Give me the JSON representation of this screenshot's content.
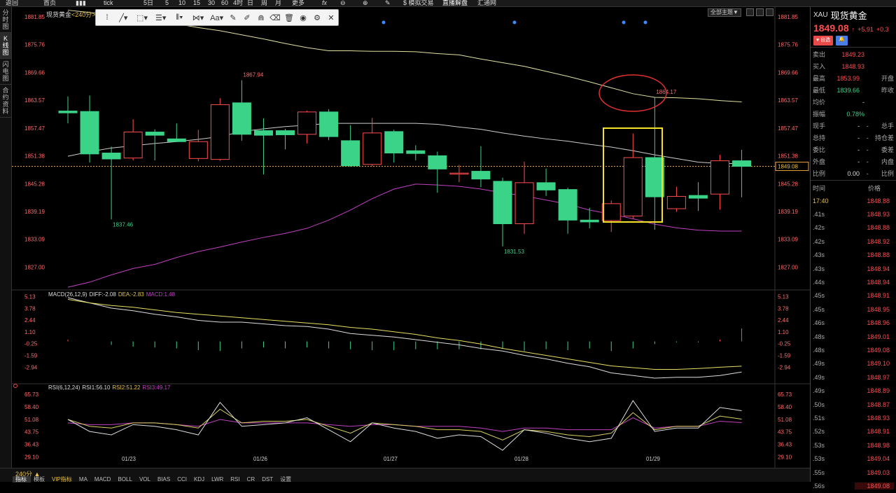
{
  "topbar": {
    "items": [
      "返回",
      "首页",
      "",
      "tick",
      "5日",
      "5",
      "10",
      "15",
      "30",
      "60",
      "4时",
      "日",
      "周",
      "月",
      "更多",
      "fx",
      "",
      "",
      "",
      "$ 模拟交易",
      "直播解盘",
      "汇通网"
    ]
  },
  "left_tabs": [
    "分时图",
    "K线图",
    "闪电图",
    "合约资料"
  ],
  "chart": {
    "title": "现货黄金",
    "period_suffix": "<240分>",
    "scheme_button": "全部主题▼",
    "price_axis": [
      "1881.85",
      "1875.76",
      "1869.66",
      "1863.57",
      "1857.47",
      "1851.38",
      "1845.28",
      "1839.19",
      "1833.09",
      "1827.00"
    ],
    "current_price_tag": "1849.08",
    "annotations": {
      "high1": "1867.94",
      "low1": "1837.46",
      "low2": "1831.53",
      "high2": "1864.17"
    },
    "macd_label": "MACD(26,12,9)",
    "macd_diff": "DIFF:-2.08",
    "macd_dea": "DEA:-2.83",
    "macd_macd": "MACD:1.48",
    "macd_axis": [
      "5.13",
      "3.78",
      "2.44",
      "1.10",
      "-0.25",
      "-1.59",
      "-2.94"
    ],
    "rsi_label": "RSI(6,12,24)",
    "rsi1": "RSI1:56.10",
    "rsi2": "RSI2:51.22",
    "rsi3": "RSI3:49.17",
    "rsi_axis": [
      "65.73",
      "58.40",
      "51.08",
      "43.75",
      "36.43",
      "29.10"
    ],
    "dates": [
      "01/23",
      "01/26",
      "01/27",
      "01/28",
      "01/29"
    ],
    "colors": {
      "up": "#ff4d4f",
      "down": "#3bd388",
      "ma1": "#e0e0a0",
      "ma2": "#cccccc",
      "ma3": "#c040c0",
      "highlight": "#f5e02a",
      "circle": "#e03030"
    }
  },
  "chart_data": {
    "type": "candlestick",
    "title": "现货黄金<240分>",
    "ylim": [
      1822,
      1884
    ],
    "candles": [
      {
        "o": 1861.2,
        "c": 1860.8,
        "h": 1864.4,
        "l": 1858.5
      },
      {
        "o": 1861.1,
        "c": 1851.8,
        "h": 1864.6,
        "l": 1849.9
      },
      {
        "o": 1852.0,
        "c": 1850.7,
        "h": 1853.4,
        "l": 1837.46
      },
      {
        "o": 1850.9,
        "c": 1856.6,
        "h": 1859.4,
        "l": 1850.4
      },
      {
        "o": 1856.6,
        "c": 1855.9,
        "h": 1857.2,
        "l": 1850.4
      },
      {
        "o": 1855.1,
        "c": 1854.5,
        "h": 1858.5,
        "l": 1854.4
      },
      {
        "o": 1850.8,
        "c": 1854.5,
        "h": 1857.1,
        "l": 1850.2
      },
      {
        "o": 1850.6,
        "c": 1862.6,
        "h": 1864.0,
        "l": 1850.3
      },
      {
        "o": 1863.0,
        "c": 1856.1,
        "h": 1867.94,
        "l": 1854.7
      },
      {
        "o": 1856.9,
        "c": 1855.9,
        "h": 1859.6,
        "l": 1847.3
      },
      {
        "o": 1856.9,
        "c": 1856.0,
        "h": 1857.3,
        "l": 1852.8
      },
      {
        "o": 1856.1,
        "c": 1861.0,
        "h": 1861.3,
        "l": 1854.1
      },
      {
        "o": 1861.0,
        "c": 1855.6,
        "h": 1861.6,
        "l": 1854.8
      },
      {
        "o": 1854.7,
        "c": 1849.2,
        "h": 1858.1,
        "l": 1849.0
      },
      {
        "o": 1849.5,
        "c": 1856.4,
        "h": 1859.7,
        "l": 1849.1
      },
      {
        "o": 1856.7,
        "c": 1852.0,
        "h": 1857.1,
        "l": 1849.9
      },
      {
        "o": 1852.5,
        "c": 1851.9,
        "h": 1853.7,
        "l": 1850.4
      },
      {
        "o": 1851.4,
        "c": 1848.5,
        "h": 1852.3,
        "l": 1843.3
      },
      {
        "o": 1847.4,
        "c": 1847.6,
        "h": 1849.4,
        "l": 1845.6
      },
      {
        "o": 1848.0,
        "c": 1846.3,
        "h": 1853.5,
        "l": 1844.5
      },
      {
        "o": 1845.8,
        "c": 1836.5,
        "h": 1846.6,
        "l": 1831.53
      },
      {
        "o": 1836.5,
        "c": 1845.5,
        "h": 1850.1,
        "l": 1834.3
      },
      {
        "o": 1845.5,
        "c": 1843.9,
        "h": 1848.6,
        "l": 1842.6
      },
      {
        "o": 1844.0,
        "c": 1837.3,
        "h": 1844.4,
        "l": 1834.3
      },
      {
        "o": 1837.3,
        "c": 1836.9,
        "h": 1840.0,
        "l": 1835.5
      },
      {
        "o": 1837.2,
        "c": 1840.9,
        "h": 1841.6,
        "l": 1834.7
      },
      {
        "o": 1838.2,
        "c": 1851.0,
        "h": 1856.3,
        "l": 1837.7
      },
      {
        "o": 1851.0,
        "c": 1842.4,
        "h": 1864.17,
        "l": 1835.2
      },
      {
        "o": 1839.8,
        "c": 1842.5,
        "h": 1844.6,
        "l": 1839.1
      },
      {
        "o": 1842.7,
        "c": 1842.1,
        "h": 1845.6,
        "l": 1839.3
      },
      {
        "o": 1843.0,
        "c": 1850.3,
        "h": 1851.6,
        "l": 1839.6
      },
      {
        "o": 1850.3,
        "c": 1849.08,
        "h": 1852.7,
        "l": 1842.3
      }
    ],
    "ma_white": [
      1851.3,
      1852.3,
      1853.1,
      1853.6,
      1854.1,
      1854.5,
      1855.0,
      1855.6,
      1856.7,
      1857.3,
      1857.8,
      1858.1,
      1858.5,
      1858.5,
      1858.5,
      1858.5,
      1858.5,
      1858.3,
      1857.7,
      1857.2,
      1856.4,
      1855.7,
      1855.1,
      1854.6,
      1853.9,
      1853.3,
      1852.5,
      1851.6,
      1850.8,
      1850.0,
      1849.7,
      1849.7
    ],
    "ma_yellow": [
      1883.3,
      1882.8,
      1882.3,
      1881.6,
      1880.9,
      1880.3,
      1879.5,
      1878.8,
      1877.9,
      1877.0,
      1876.0,
      1875.1,
      1874.4,
      1874.4,
      1874.3,
      1874.3,
      1874.2,
      1873.8,
      1873.5,
      1872.6,
      1871.8,
      1871.0,
      1869.9,
      1868.8,
      1867.6,
      1866.3,
      1865.0,
      1864.2,
      1864.1,
      1863.9,
      1863.5,
      1863.2
    ],
    "ma_purple": [
      1822.6,
      1823.7,
      1825.3,
      1826.7,
      1827.6,
      1829.1,
      1830.4,
      1831.4,
      1832.5,
      1833.5,
      1834.4,
      1835.5,
      1837.3,
      1839.5,
      1842.0,
      1844.1,
      1845.2,
      1845.0,
      1844.7,
      1844.1,
      1843.3,
      1842.6,
      1841.7,
      1840.8,
      1839.5,
      1838.6,
      1837.6,
      1836.4,
      1835.6,
      1835.1,
      1834.9,
      1834.9
    ],
    "macd_ylim": [
      -4.6,
      5.4
    ],
    "macd_diff": [
      5.0,
      4.4,
      3.8,
      3.5,
      3.1,
      2.8,
      2.4,
      2.2,
      2.2,
      2.0,
      1.8,
      1.7,
      1.4,
      0.9,
      0.7,
      0.5,
      0.2,
      -0.1,
      -0.4,
      -0.8,
      -1.1,
      -1.6,
      -2.0,
      -2.5,
      -2.9,
      -3.6,
      -3.9,
      -4.2,
      -4.1,
      -4.1,
      -3.9,
      -3.5
    ],
    "macd_dea": [
      4.8,
      4.4,
      4.1,
      3.9,
      3.6,
      3.3,
      3.1,
      2.9,
      2.7,
      2.5,
      2.3,
      2.1,
      1.9,
      1.6,
      1.4,
      1.1,
      0.8,
      0.4,
      0.1,
      -0.3,
      -0.8,
      -1.2,
      -1.6,
      -2.0,
      -2.4,
      -2.8,
      -3.0,
      -3.2,
      -3.2,
      -3.1,
      -2.95,
      -2.83
    ],
    "macd_bar": [
      0.2,
      0.0,
      -0.4,
      -0.6,
      -0.7,
      -0.8,
      -1.0,
      -1.1,
      -0.8,
      -0.7,
      -0.8,
      -0.7,
      -0.8,
      -0.9,
      -1.0,
      -1.0,
      -0.9,
      -0.9,
      -0.9,
      -0.9,
      -0.8,
      -1.1,
      -0.9,
      -1.0,
      -0.8,
      -1.1,
      -0.8,
      -0.3,
      -0.1,
      -0.1,
      0.2,
      1.48
    ],
    "rsi_ylim": [
      24,
      69
    ],
    "rsi1": [
      51.0,
      44.0,
      42.0,
      48.0,
      47.0,
      45.0,
      42.0,
      61.0,
      47.0,
      48.0,
      49.0,
      52.0,
      45.0,
      38.0,
      49.0,
      46.0,
      44.0,
      40.0,
      42.0,
      41.0,
      33.0,
      45.0,
      43.0,
      40.0,
      38.0,
      40.0,
      62.0,
      44.0,
      46.0,
      46.0,
      58.0,
      56.1
    ],
    "rsi2": [
      51.0,
      47.0,
      46.0,
      49.0,
      49.0,
      48.0,
      46.0,
      57.0,
      49.0,
      50.0,
      50.0,
      51.0,
      47.0,
      43.0,
      49.0,
      48.0,
      47.0,
      45.0,
      45.0,
      44.0,
      39.0,
      45.0,
      44.0,
      42.0,
      41.0,
      43.0,
      55.0,
      45.0,
      47.0,
      47.0,
      53.0,
      51.22
    ],
    "rsi3": [
      49.0,
      48.0,
      48.0,
      49.0,
      49.0,
      48.0,
      47.0,
      51.0,
      49.0,
      49.0,
      49.0,
      49.0,
      48.0,
      47.0,
      48.0,
      48.0,
      47.0,
      47.0,
      47.0,
      46.0,
      44.0,
      46.0,
      46.0,
      45.0,
      45.0,
      45.0,
      52.0,
      46.0,
      47.0,
      47.0,
      50.0,
      49.17
    ]
  },
  "right_panel": {
    "code": "XAU",
    "name": "现货黄金",
    "price": "1849.08",
    "arrow": "↑",
    "change": "+5.91",
    "change_pct": "+0.3",
    "btn_fav": "自选",
    "btn_alert": "",
    "rows": [
      {
        "k": "卖出",
        "v": "1849.23",
        "vc": "red"
      },
      {
        "k": "买入",
        "v": "1848.93",
        "vc": "red"
      },
      {
        "k": "最高",
        "v": "1853.99",
        "vc": "red",
        "k2": "开盘",
        "v2": ""
      },
      {
        "k": "最低",
        "v": "1839.66",
        "vc": "green",
        "k2": "昨收",
        "v2": ""
      },
      {
        "k": "均价",
        "v": "-",
        "vc": "white"
      },
      {
        "k": "振幅",
        "v": "0.78%",
        "vc": "green"
      },
      {
        "k": "现手",
        "v": "-",
        "vc": "white",
        "k2": "总手"
      },
      {
        "k": "总持",
        "v": "-",
        "vc": "white",
        "k2": "持仓差"
      },
      {
        "k": "委比",
        "v": "-",
        "vc": "white",
        "k2": "委差"
      },
      {
        "k": "外盘",
        "v": "-",
        "vc": "white",
        "k2": "内盘"
      },
      {
        "k": "比例",
        "v": "0.00",
        "vc": "white",
        "k2": "比例"
      }
    ],
    "tick_header": [
      "时间",
      "价格"
    ],
    "ticks": [
      {
        "t": "17:40",
        "p": "1848.88"
      },
      {
        "t": ".41s",
        "p": "1848.93"
      },
      {
        "t": ".42s",
        "p": "1848.88"
      },
      {
        "t": ".42s",
        "p": "1848.92"
      },
      {
        "t": ".43s",
        "p": "1848.88"
      },
      {
        "t": ".43s",
        "p": "1848.94"
      },
      {
        "t": ".44s",
        "p": "1848.94"
      },
      {
        "t": ".45s",
        "p": "1848.91"
      },
      {
        "t": ".45s",
        "p": "1848.95"
      },
      {
        "t": ".46s",
        "p": "1848.96"
      },
      {
        "t": ".48s",
        "p": "1849.01"
      },
      {
        "t": ".48s",
        "p": "1849.08"
      },
      {
        "t": ".49s",
        "p": "1849.10"
      },
      {
        "t": ".49s",
        "p": "1848.97"
      },
      {
        "t": ".49s",
        "p": "1848.89"
      },
      {
        "t": ".50s",
        "p": "1848.87"
      },
      {
        "t": ".51s",
        "p": "1848.93"
      },
      {
        "t": ".52s",
        "p": "1848.91"
      },
      {
        "t": ".53s",
        "p": "1848.98"
      },
      {
        "t": ".53s",
        "p": "1849.04"
      },
      {
        "t": ".55s",
        "p": "1849.03"
      },
      {
        "t": ".56s",
        "p": "1849.08"
      }
    ]
  },
  "bottom": {
    "period": "240分 ▲",
    "tabs": [
      "指标",
      "模板",
      "VIP指标",
      "MA",
      "MACD",
      "BOLL",
      "VOL",
      "BIAS",
      "CCI",
      "KDJ",
      "LWR",
      "RSI",
      "CR",
      "DST",
      "设置"
    ]
  }
}
